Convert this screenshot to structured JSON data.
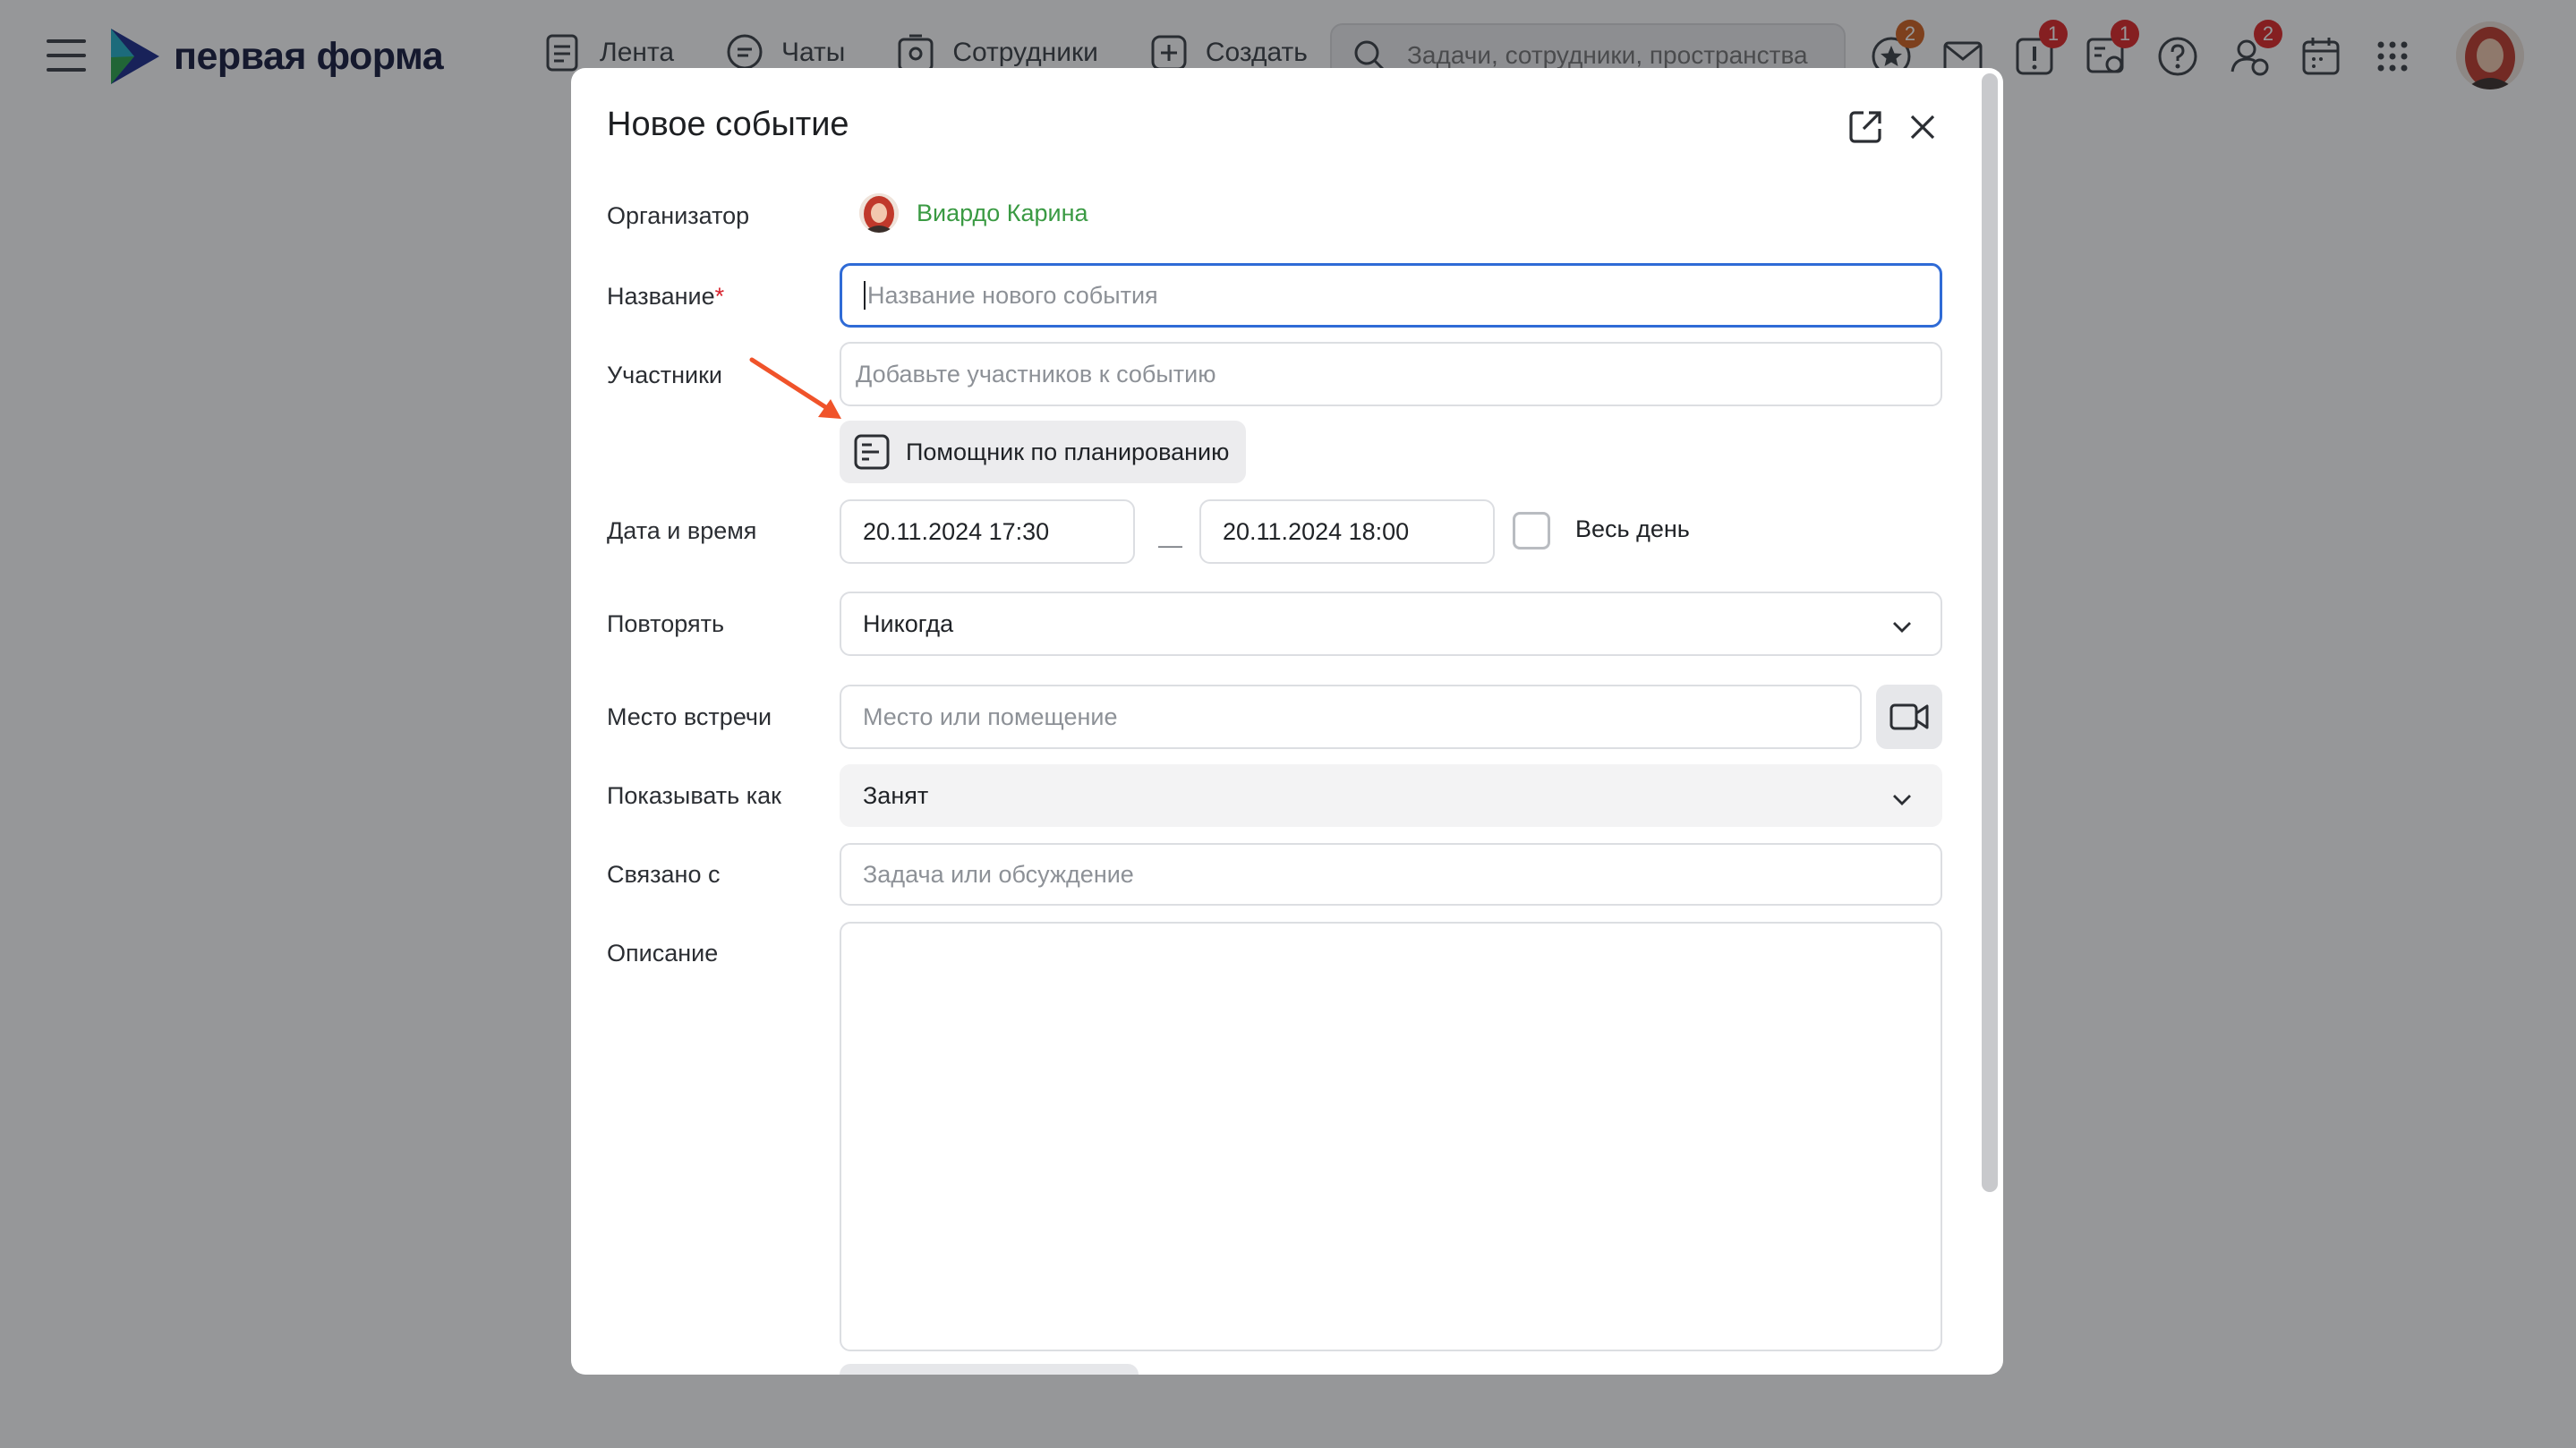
{
  "app": {
    "logo_text": "первая форма"
  },
  "nav": [
    {
      "label": "Лента",
      "icon": "feed-icon"
    },
    {
      "label": "Чаты",
      "icon": "chat-icon"
    },
    {
      "label": "Сотрудники",
      "icon": "employees-icon"
    },
    {
      "label": "Создать",
      "icon": "plus-square-icon"
    }
  ],
  "search": {
    "placeholder": "Задачи, сотрудники, пространства"
  },
  "toolbar_icons": [
    {
      "icon": "star-icon",
      "badge": "2",
      "badge_color": "#d2621e"
    },
    {
      "icon": "mail-icon",
      "badge": ""
    },
    {
      "icon": "alert-icon",
      "badge": "1",
      "badge_color": "#e02626"
    },
    {
      "icon": "tasks-board-icon",
      "badge": "1",
      "badge_color": "#e02626"
    },
    {
      "icon": "help-icon",
      "badge": ""
    },
    {
      "icon": "user-settings-icon",
      "badge": "2",
      "badge_color": "#e02626"
    },
    {
      "icon": "calendar-icon",
      "badge": ""
    },
    {
      "icon": "apps-grid-icon",
      "badge": ""
    }
  ],
  "modal": {
    "title": "Новое событие",
    "organizer": {
      "label": "Организатор",
      "name": "Виардо Карина"
    },
    "name": {
      "label": "Название",
      "required_mark": "*",
      "placeholder": "Название нового события"
    },
    "participants": {
      "label": "Участники",
      "placeholder": "Добавьте участников к событию",
      "helper_button": "Помощник по планированию"
    },
    "datetime": {
      "label": "Дата и время",
      "start": "20.11.2024 17:30",
      "separator": "—",
      "end": "20.11.2024 18:00",
      "all_day_label": "Весь день",
      "all_day_checked": false
    },
    "repeat": {
      "label": "Повторять",
      "value": "Никогда"
    },
    "location": {
      "label": "Место встречи",
      "placeholder": "Место или помещение"
    },
    "show_as": {
      "label": "Показывать как",
      "value": "Занят"
    },
    "related": {
      "label": "Связано с",
      "placeholder": "Задача или обсуждение"
    },
    "description": {
      "label": "Описание",
      "value": ""
    }
  },
  "colors": {
    "accent": "#2f6bd6",
    "organizer_name": "#3a9a43",
    "required": "#d8242f",
    "annotation_arrow": "#f0532a"
  }
}
